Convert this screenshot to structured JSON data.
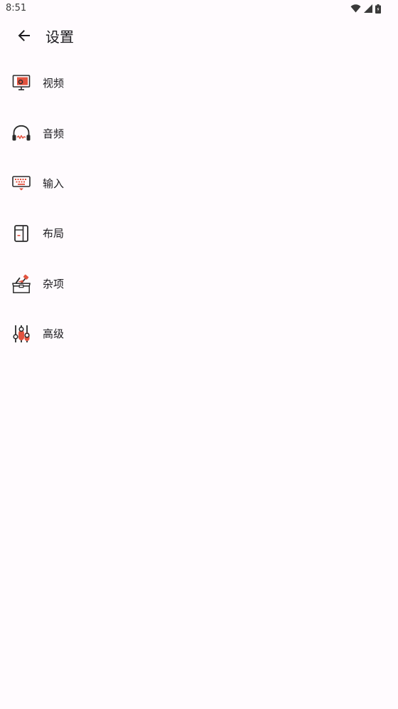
{
  "status_bar": {
    "time": "8:51",
    "icons": [
      "wifi-icon",
      "signal-icon",
      "battery-icon"
    ]
  },
  "app_bar": {
    "back_icon": "arrow-left-icon",
    "title": "设置"
  },
  "settings": {
    "items": [
      {
        "label": "视频",
        "icon": "monitor-icon"
      },
      {
        "label": "音频",
        "icon": "headphones-icon"
      },
      {
        "label": "输入",
        "icon": "keyboard-icon"
      },
      {
        "label": "布局",
        "icon": "layout-icon"
      },
      {
        "label": "杂项",
        "icon": "toolbox-icon"
      },
      {
        "label": "高级",
        "icon": "sliders-icon"
      }
    ]
  },
  "colors": {
    "background": "#FFFBFE",
    "text": "#1C1B1F",
    "accent": "#E2533F",
    "icon_outline": "#2B2B2B"
  }
}
